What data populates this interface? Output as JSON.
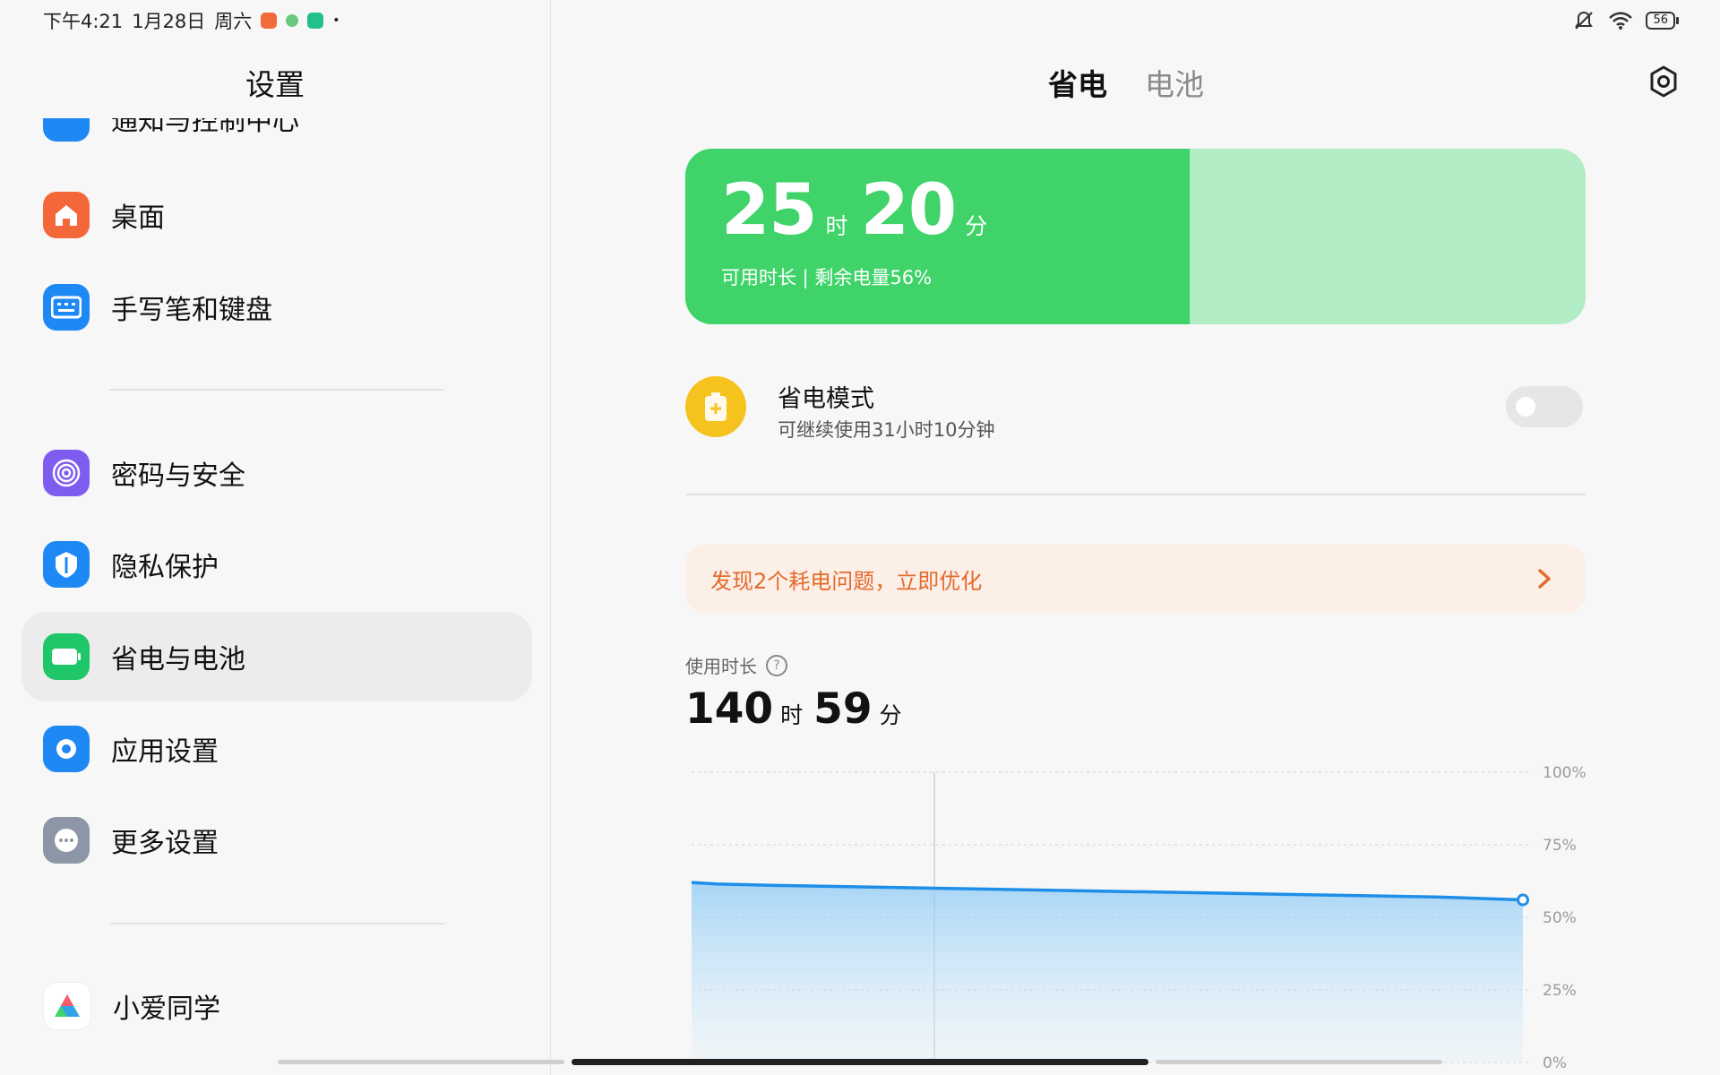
{
  "status_bar": {
    "time": "下午4:21",
    "date": "1月28日",
    "weekday": "周六",
    "battery_level": "56"
  },
  "left": {
    "title": "设置",
    "items": [
      {
        "label": "通知与控制中心",
        "icon": "notification-icon",
        "color": "#1e88f5"
      },
      {
        "label": "桌面",
        "icon": "home-icon",
        "color": "#f4673a"
      },
      {
        "label": "手写笔和键盘",
        "icon": "keyboard-icon",
        "color": "#1e88f5"
      },
      {
        "label": "密码与安全",
        "icon": "fingerprint-icon",
        "color": "#7e5cf0"
      },
      {
        "label": "隐私保护",
        "icon": "privacy-shield-icon",
        "color": "#1e88f5"
      },
      {
        "label": "省电与电池",
        "icon": "battery-icon",
        "color": "#1fc768"
      },
      {
        "label": "应用设置",
        "icon": "gear-icon",
        "color": "#1e88f5"
      },
      {
        "label": "更多设置",
        "icon": "more-icon",
        "color": "#8c96a6"
      },
      {
        "label": "小爱同学",
        "icon": "xiaoai-icon",
        "color": "#ffffff"
      }
    ]
  },
  "right": {
    "tabs": [
      "省电",
      "电池"
    ],
    "battery_card": {
      "hours": "25",
      "hours_unit": "时",
      "minutes": "20",
      "minutes_unit": "分",
      "subtitle": "可用时长 | 剩余电量56%",
      "charge_fraction": 0.56
    },
    "power_saving": {
      "title": "省电模式",
      "subtitle": "可继续使用31小时10分钟",
      "enabled": false
    },
    "alert": {
      "text": "发现2个耗电问题，立即优化"
    },
    "usage": {
      "label": "使用时长",
      "hours": "140",
      "hours_unit": "时",
      "minutes": "59",
      "minutes_unit": "分"
    }
  },
  "chart_data": {
    "type": "area",
    "x": [
      0,
      0.03,
      0.1,
      0.3,
      0.5,
      0.7,
      0.9,
      1.0
    ],
    "values": [
      62,
      61.5,
      61,
      60,
      59,
      58,
      57,
      56
    ],
    "y_ticks": [
      "100%",
      "75%",
      "50%",
      "25%",
      "0%"
    ],
    "ylim": [
      0,
      100
    ],
    "grid": true,
    "line_color": "#1e8ee8"
  },
  "colors": {
    "accent_green": "#3fd36a",
    "light_green": "#b2ecc4",
    "alert_orange": "#e56a2b",
    "saver_yellow": "#f6c21d"
  }
}
